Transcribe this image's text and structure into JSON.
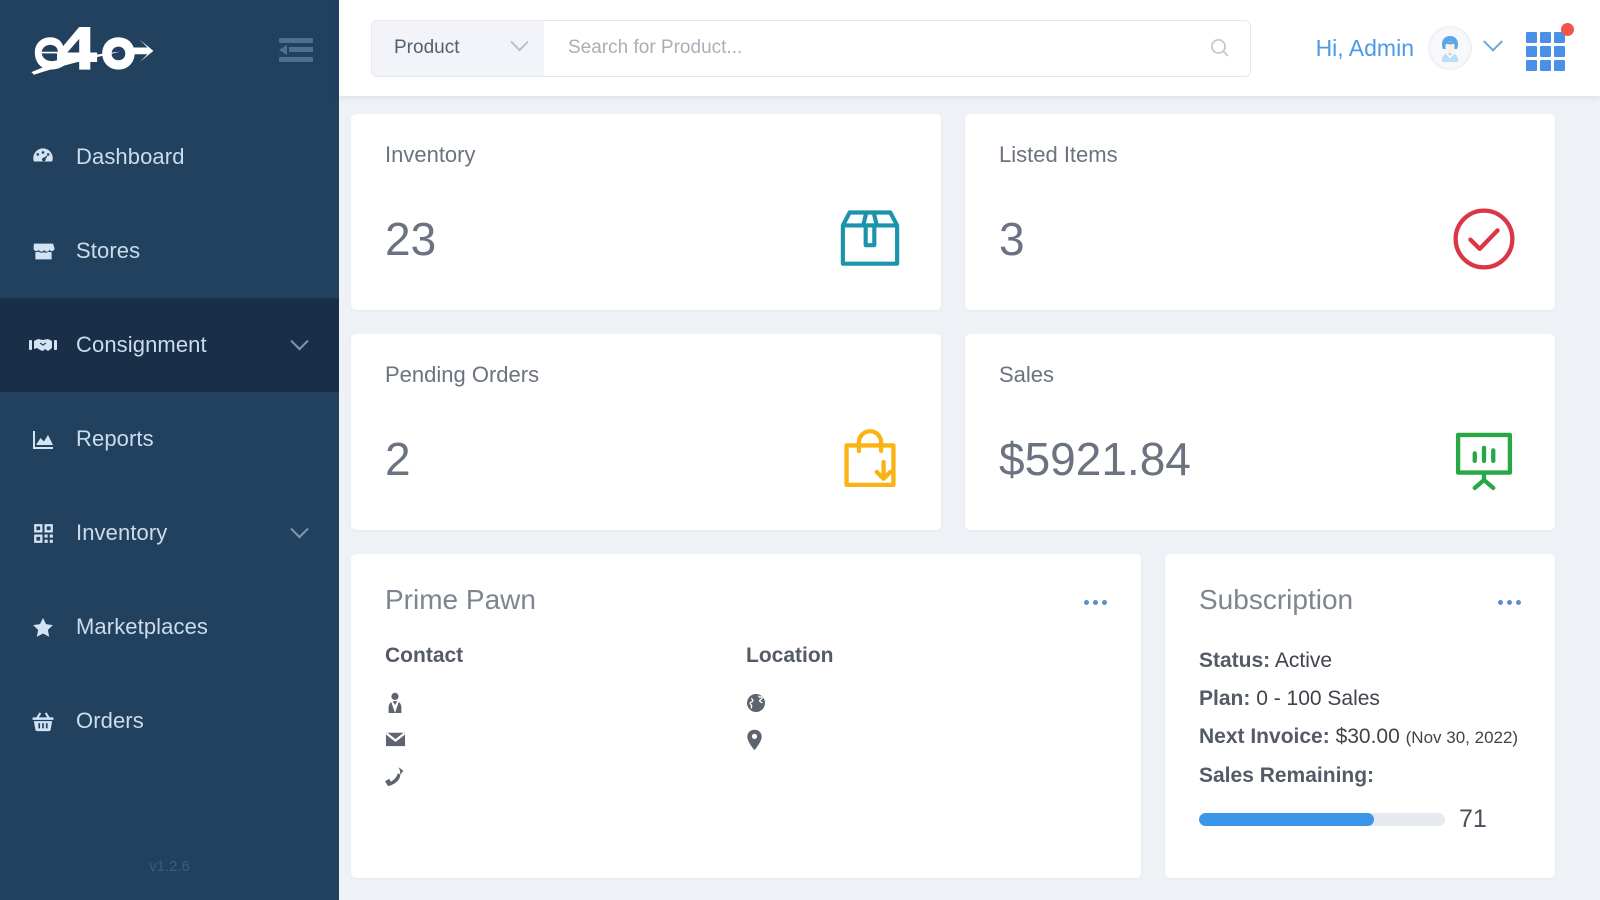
{
  "sidebar": {
    "logo_alt": "e4o",
    "version": "v1.2.6",
    "collapse_icon": "collapse-menu-icon",
    "items": [
      {
        "label": "Dashboard",
        "icon": "dashboard-gauge-icon",
        "active": false,
        "expandable": false
      },
      {
        "label": "Stores",
        "icon": "store-icon",
        "active": false,
        "expandable": false
      },
      {
        "label": "Consignment",
        "icon": "handshake-icon",
        "active": true,
        "expandable": true
      },
      {
        "label": "Reports",
        "icon": "chart-area-icon",
        "active": false,
        "expandable": false
      },
      {
        "label": "Inventory",
        "icon": "qr-boxes-icon",
        "active": false,
        "expandable": true
      },
      {
        "label": "Marketplaces",
        "icon": "star-icon",
        "active": false,
        "expandable": false
      },
      {
        "label": "Orders",
        "icon": "basket-icon",
        "active": false,
        "expandable": false
      }
    ]
  },
  "topbar": {
    "search_category": "Product",
    "search_category_icon": "chevron-down-icon",
    "search_placeholder": "Search for Product...",
    "search_value": "",
    "search_icon": "search-icon",
    "greeting": "Hi, Admin",
    "avatar_icon": "user-avatar",
    "user_menu_icon": "chevron-down-icon",
    "apps_icon": "apps-grid-icon",
    "notification_badge": true
  },
  "stats": [
    {
      "title": "Inventory",
      "value": "23",
      "icon": "package-box-icon",
      "color": "#1b94ab"
    },
    {
      "title": "Listed Items",
      "value": "3",
      "icon": "check-circle-icon",
      "color": "#dc3545"
    },
    {
      "title": "Pending Orders",
      "value": "2",
      "icon": "bag-download-icon",
      "color": "#fbb313"
    },
    {
      "title": "Sales",
      "value": "$5921.84",
      "icon": "presentation-chart-icon",
      "color": "#28a745"
    }
  ],
  "store_panel": {
    "title": "Prime Pawn",
    "menu_icon": "more-options-icon",
    "contact": {
      "heading": "Contact",
      "rows": [
        {
          "icon": "person-tie-icon",
          "value": ""
        },
        {
          "icon": "envelope-icon",
          "value": ""
        },
        {
          "icon": "phone-icon",
          "value": ""
        }
      ]
    },
    "location": {
      "heading": "Location",
      "rows": [
        {
          "icon": "globe-icon",
          "value": ""
        },
        {
          "icon": "map-pin-icon",
          "value": ""
        }
      ]
    }
  },
  "subscription": {
    "title": "Subscription",
    "menu_icon": "more-options-icon",
    "status_label": "Status:",
    "status_value": "Active",
    "plan_label": "Plan:",
    "plan_value": "0 - 100 Sales",
    "invoice_label": "Next Invoice:",
    "invoice_value": "$30.00",
    "invoice_date": "(Nov 30, 2022)",
    "remaining_label": "Sales Remaining:",
    "remaining_value": "71",
    "progress_percent": 71,
    "progress_color": "#3b95e8"
  }
}
